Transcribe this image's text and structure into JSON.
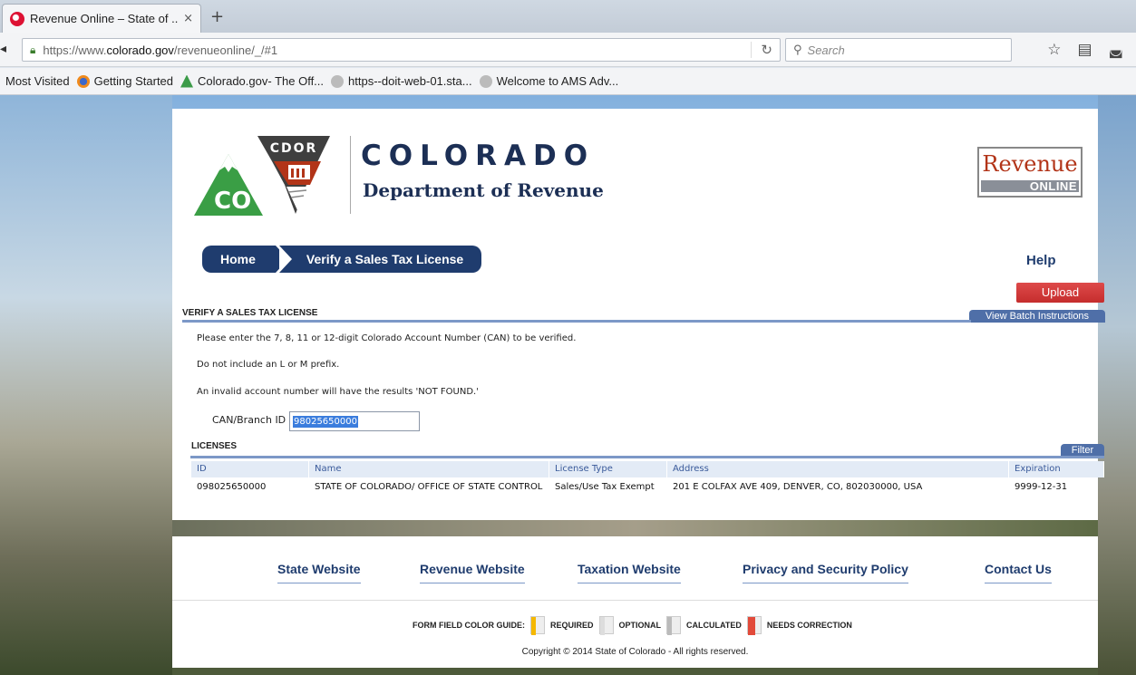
{
  "browser": {
    "tab_title": "Revenue Online – State of ...",
    "tab_close": "×",
    "new_tab": "+",
    "url_prefix": "https://www.",
    "url_domain": "colorado.gov",
    "url_suffix": "/revenueonline/_/#1",
    "search_placeholder": "Search",
    "bookmarks": [
      {
        "label": "Most Visited"
      },
      {
        "label": "Getting Started"
      },
      {
        "label": "Colorado.gov- The Off..."
      },
      {
        "label": "https--doit-web-01.sta..."
      },
      {
        "label": "Welcome to AMS Adv..."
      }
    ]
  },
  "header": {
    "cdor": "CDOR",
    "co": "CO",
    "state": "COLORADO",
    "dept": "Department of Revenue",
    "revenue": "Revenue",
    "online": "ONLINE"
  },
  "breadcrumb": {
    "home": "Home",
    "current": "Verify a Sales Tax License"
  },
  "help_label": "Help",
  "upload_label": "Upload",
  "section": {
    "title": "VERIFY A SALES TAX LICENSE",
    "view_batch": "View Batch Instructions",
    "para1": "Please enter the 7, 8, 11 or 12-digit Colorado Account Number (CAN) to be verified.",
    "para2": "Do not include an L or M prefix.",
    "para3": "An invalid account number will have the results 'NOT FOUND.'",
    "can_label": "CAN/Branch ID",
    "can_value": "98025650000"
  },
  "licenses": {
    "title": "LICENSES",
    "filter": "Filter",
    "columns": [
      "ID",
      "Name",
      "License Type",
      "Address",
      "Expiration"
    ],
    "rows": [
      [
        "098025650000",
        "STATE OF COLORADO/ OFFICE OF STATE CONTROL",
        "Sales/Use Tax Exempt",
        "201 E COLFAX AVE 409, DENVER, CO, 802030000, USA",
        "9999-12-31"
      ]
    ]
  },
  "footer": {
    "links": [
      "State Website",
      "Revenue Website",
      "Taxation Website",
      "Privacy and Security Policy",
      "Contact Us"
    ],
    "guide_label": "FORM FIELD COLOR GUIDE:",
    "guide_required": "REQUIRED",
    "guide_optional": "OPTIONAL",
    "guide_calculated": "CALCULATED",
    "guide_needs": "NEEDS CORRECTION",
    "copyright": "Copyright © 2014 State of Colorado - All rights reserved."
  },
  "colors": {
    "navy": "#1f3c6e",
    "accent_blue": "#4f6fa8",
    "upload_red": "#c52d2d",
    "revenue_red": "#b23418"
  }
}
